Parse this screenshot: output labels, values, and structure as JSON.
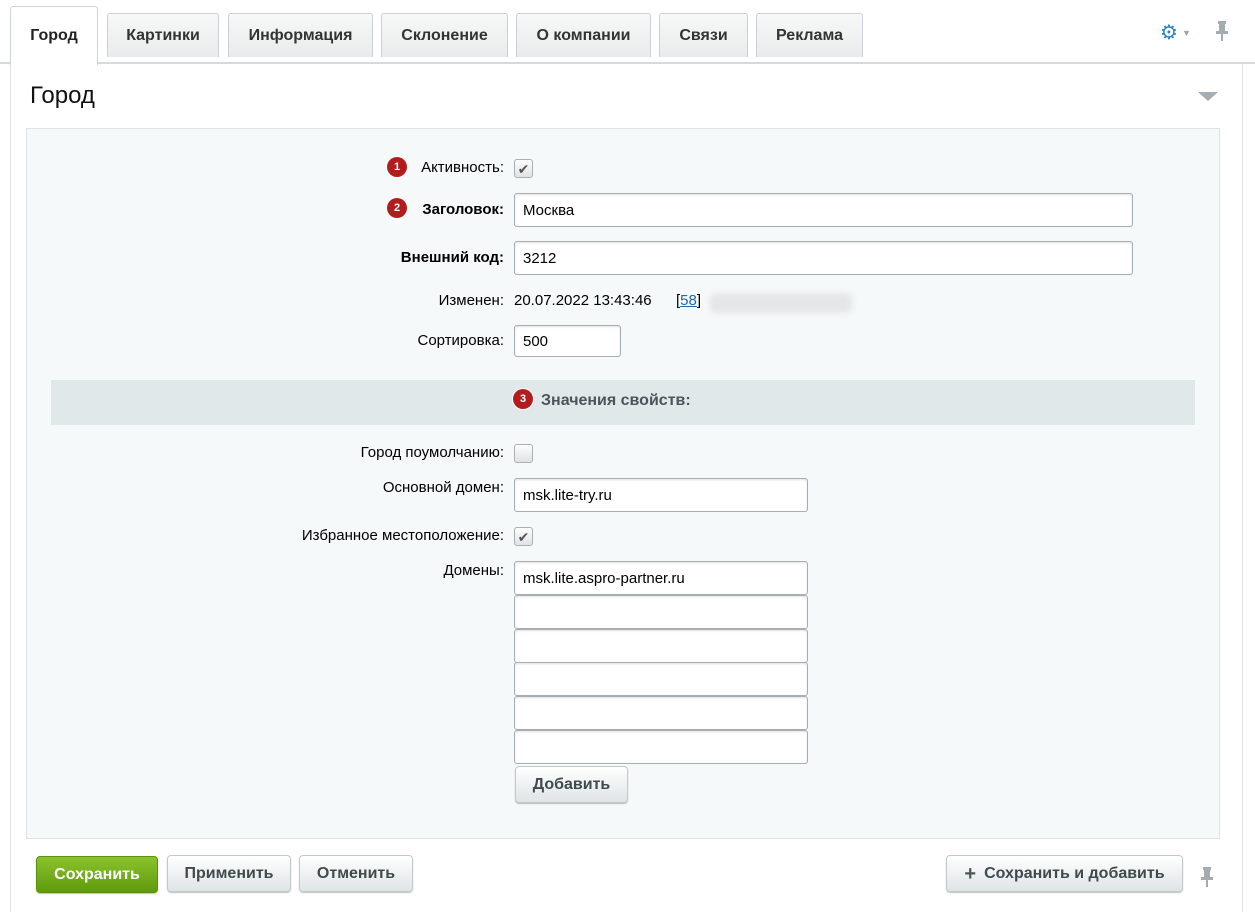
{
  "tabs": [
    {
      "label": "Город",
      "active": true
    },
    {
      "label": "Картинки"
    },
    {
      "label": "Информация"
    },
    {
      "label": "Склонение"
    },
    {
      "label": "О компании"
    },
    {
      "label": "Связи"
    },
    {
      "label": "Реклама"
    }
  ],
  "section": {
    "title": "Город"
  },
  "badges": [
    "1",
    "2",
    "3"
  ],
  "fields": {
    "active": {
      "label": "Активность:",
      "checked": true
    },
    "title": {
      "label": "Заголовок:",
      "value": "Москва"
    },
    "external_code": {
      "label": "Внешний код:",
      "value": "3212"
    },
    "modified": {
      "label": "Изменен:",
      "datetime": "20.07.2022 13:43:46",
      "bracket_open": "[",
      "user_id": "58",
      "bracket_close": "]"
    },
    "sort": {
      "label": "Сортировка:",
      "value": "500"
    }
  },
  "properties": {
    "heading": "Значения свойств:",
    "default_city": {
      "label": "Город поумолчанию:",
      "checked": false
    },
    "main_domain": {
      "label": "Основной домен:",
      "value": "msk.lite-try.ru"
    },
    "favorite_location": {
      "label": "Избранное местоположение:",
      "checked": true
    },
    "domains": {
      "label": "Домены:",
      "values": [
        "msk.lite.aspro-partner.ru",
        "",
        "",
        "",
        "",
        ""
      ],
      "add_label": "Добавить"
    }
  },
  "footer": {
    "save": "Сохранить",
    "apply": "Применить",
    "cancel": "Отменить",
    "save_and_add": "Сохранить и добавить"
  },
  "colors": {
    "accent": "#2c83c9",
    "save_green": "#6faa19",
    "badge_red": "#b31c1c"
  }
}
